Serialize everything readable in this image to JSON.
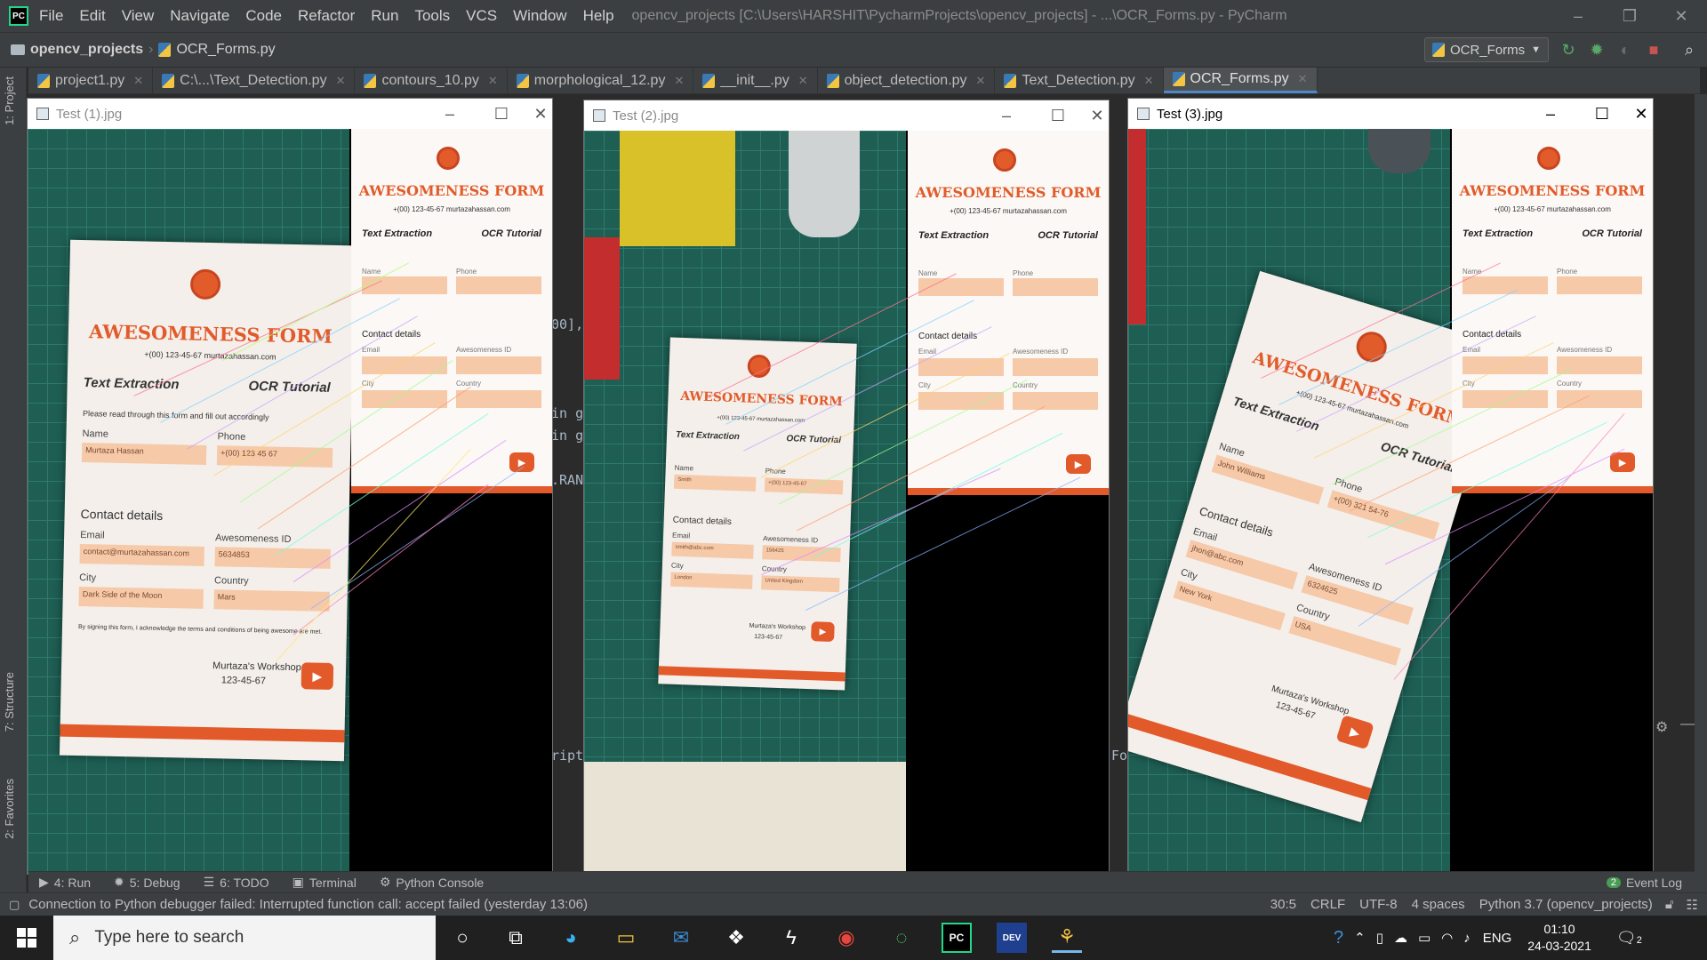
{
  "titlebar": {
    "logo_text": "PC",
    "menu": [
      "File",
      "Edit",
      "View",
      "Navigate",
      "Code",
      "Refactor",
      "Run",
      "Tools",
      "VCS",
      "Window",
      "Help"
    ],
    "title": "opencv_projects [C:\\Users\\HARSHIT\\PycharmProjects\\opencv_projects] - ...\\OCR_Forms.py - PyCharm"
  },
  "navbar": {
    "project": "opencv_projects",
    "file": "OCR_Forms.py",
    "run_config": "OCR_Forms"
  },
  "tabs": [
    "project1.py",
    "C:\\...\\Text_Detection.py",
    "contours_10.py",
    "morphological_12.py",
    "__init__.py",
    "object_detection.py",
    "Text_Detection.py",
    "OCR_Forms.py"
  ],
  "left_tools": {
    "project": "1: Project",
    "structure": "7: Structure",
    "favorites": "2: Favorites"
  },
  "code_fragments": [
    "00],",
    "in g",
    "in g",
    ".RANS",
    "ript",
    "Fo"
  ],
  "cv_windows": [
    {
      "title": "Test (1).jpg"
    },
    {
      "title": "Test (2).jpg"
    },
    {
      "title": "Test (3).jpg"
    }
  ],
  "form": {
    "title": "AWESOMENESS FORM",
    "contact": "+(00) 123-45-67 murtazahassan.com",
    "section1": "Text Extraction",
    "section2": "OCR Tutorial",
    "intro": "Please read through this form and fill out accordingly",
    "name_label": "Name",
    "phone_label": "Phone",
    "contact_details": "Contact details",
    "email_label": "Email",
    "id_label": "Awesomeness ID",
    "city_label": "City",
    "country_label": "Country",
    "footer": "Murtaza's Workshop",
    "footer_phone": "123-45-67",
    "agree": "By signing this form, I acknowledge the terms and conditions of being awesome are met."
  },
  "form1_values": {
    "name": "Murtaza Hassan",
    "phone": "+(00) 123 45 67",
    "email": "contact@murtazahassan.com",
    "id": "5634853",
    "city": "Dark Side of the Moon",
    "country": "Mars"
  },
  "form2_values": {
    "name": "Smith",
    "phone": "+(00) 123-45-67",
    "email": "smith@abc.com",
    "id": "156425",
    "city": "London",
    "country": "United Kingdom"
  },
  "form3_values": {
    "name": "John Williams",
    "phone": "+(00) 321 54-76",
    "email": "jhon@abc.com",
    "id": "6324625",
    "city": "New York",
    "country": "USA"
  },
  "bottom_tools": [
    "4: Run",
    "5: Debug",
    "6: TODO",
    "Terminal",
    "Python Console"
  ],
  "event_log": {
    "count": "2",
    "label": "Event Log"
  },
  "status": {
    "message": "Connection to Python debugger failed: Interrupted function call: accept failed (yesterday 13:06)",
    "position": "30:5",
    "line_sep": "CRLF",
    "encoding": "UTF-8",
    "indent": "4 spaces",
    "interpreter": "Python 3.7 (opencv_projects)"
  },
  "taskbar": {
    "search_placeholder": "Type here to search",
    "lang": "ENG",
    "time": "01:10",
    "date": "24-03-2021",
    "notif_count": "2"
  },
  "colors": {
    "accent": "#e2592a",
    "ide_bg": "#2b2b2b",
    "panel": "#3c3f41"
  }
}
